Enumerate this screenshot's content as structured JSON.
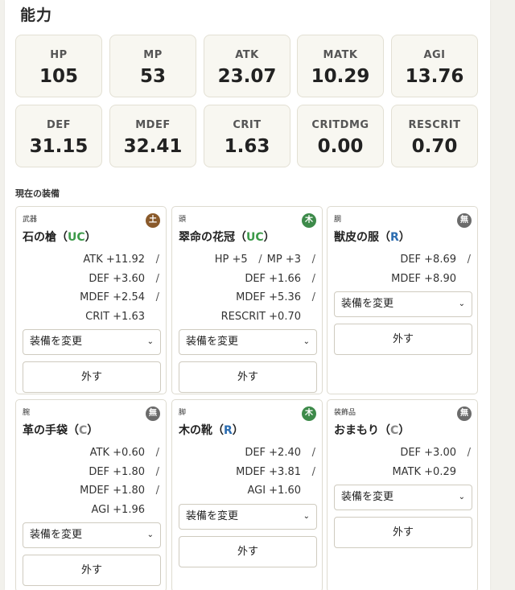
{
  "title": "能力",
  "stats": [
    {
      "label": "HP",
      "value": "105"
    },
    {
      "label": "MP",
      "value": "53"
    },
    {
      "label": "ATK",
      "value": "23.07"
    },
    {
      "label": "MATK",
      "value": "10.29"
    },
    {
      "label": "AGI",
      "value": "13.76"
    },
    {
      "label": "DEF",
      "value": "31.15"
    },
    {
      "label": "MDEF",
      "value": "32.41"
    },
    {
      "label": "CRIT",
      "value": "1.63"
    },
    {
      "label": "CRITDMG",
      "value": "0.00"
    },
    {
      "label": "RESCRIT",
      "value": "0.70"
    }
  ],
  "equipment_label": "現在の装備",
  "select_label": "装備を変更",
  "remove_label": "外す",
  "colors": {
    "earth": "#8a5a2b",
    "wood": "#3d8a4a",
    "none": "#6b6b6b",
    "uc": "#3c9a49",
    "r": "#2b6cb0",
    "c": "#888888"
  },
  "equipment": [
    {
      "slot": "武器",
      "element": "土",
      "element_color": "#8a5a2b",
      "name": "石の槍",
      "rarity": "UC",
      "rarity_color": "#3c9a49",
      "lines": [
        {
          "text": "ATK +11.92",
          "sep": "/"
        },
        {
          "text": "DEF +3.60",
          "sep": "/"
        },
        {
          "text": "MDEF +2.54",
          "sep": "/"
        },
        {
          "text": "CRIT +1.63",
          "sep": ""
        }
      ]
    },
    {
      "slot": "頭",
      "element": "木",
      "element_color": "#3d8a4a",
      "name": "翠命の花冠",
      "rarity": "UC",
      "rarity_color": "#3c9a49",
      "lines": [
        {
          "text": "HP +5",
          "sep": "/",
          "text2": "MP +3"
        },
        {
          "text": "DEF +1.66",
          "sep": "/"
        },
        {
          "text": "MDEF +5.36",
          "sep": "/"
        },
        {
          "text": "RESCRIT +0.70",
          "sep": ""
        }
      ]
    },
    {
      "slot": "胴",
      "element": "無",
      "element_color": "#6b6b6b",
      "name": "獣皮の服",
      "rarity": "R",
      "rarity_color": "#2b6cb0",
      "lines": [
        {
          "text": "DEF +8.69",
          "sep": "/"
        },
        {
          "text": "MDEF +8.90",
          "sep": ""
        }
      ]
    },
    {
      "slot": "腕",
      "element": "無",
      "element_color": "#6b6b6b",
      "name": "革の手袋",
      "rarity": "C",
      "rarity_color": "#888888",
      "lines": [
        {
          "text": "ATK +0.60",
          "sep": "/"
        },
        {
          "text": "DEF +1.80",
          "sep": "/"
        },
        {
          "text": "MDEF +1.80",
          "sep": "/"
        },
        {
          "text": "AGI +1.96",
          "sep": ""
        }
      ]
    },
    {
      "slot": "脚",
      "element": "木",
      "element_color": "#3d8a4a",
      "name": "木の靴",
      "rarity": "R",
      "rarity_color": "#2b6cb0",
      "lines": [
        {
          "text": "DEF +2.40",
          "sep": "/"
        },
        {
          "text": "MDEF +3.81",
          "sep": "/"
        },
        {
          "text": "AGI +1.60",
          "sep": ""
        }
      ]
    },
    {
      "slot": "装飾品",
      "element": "無",
      "element_color": "#6b6b6b",
      "name": "おまもり",
      "rarity": "C",
      "rarity_color": "#888888",
      "lines": [
        {
          "text": "DEF +3.00",
          "sep": "/"
        },
        {
          "text": "MATK +0.29",
          "sep": ""
        }
      ]
    }
  ]
}
